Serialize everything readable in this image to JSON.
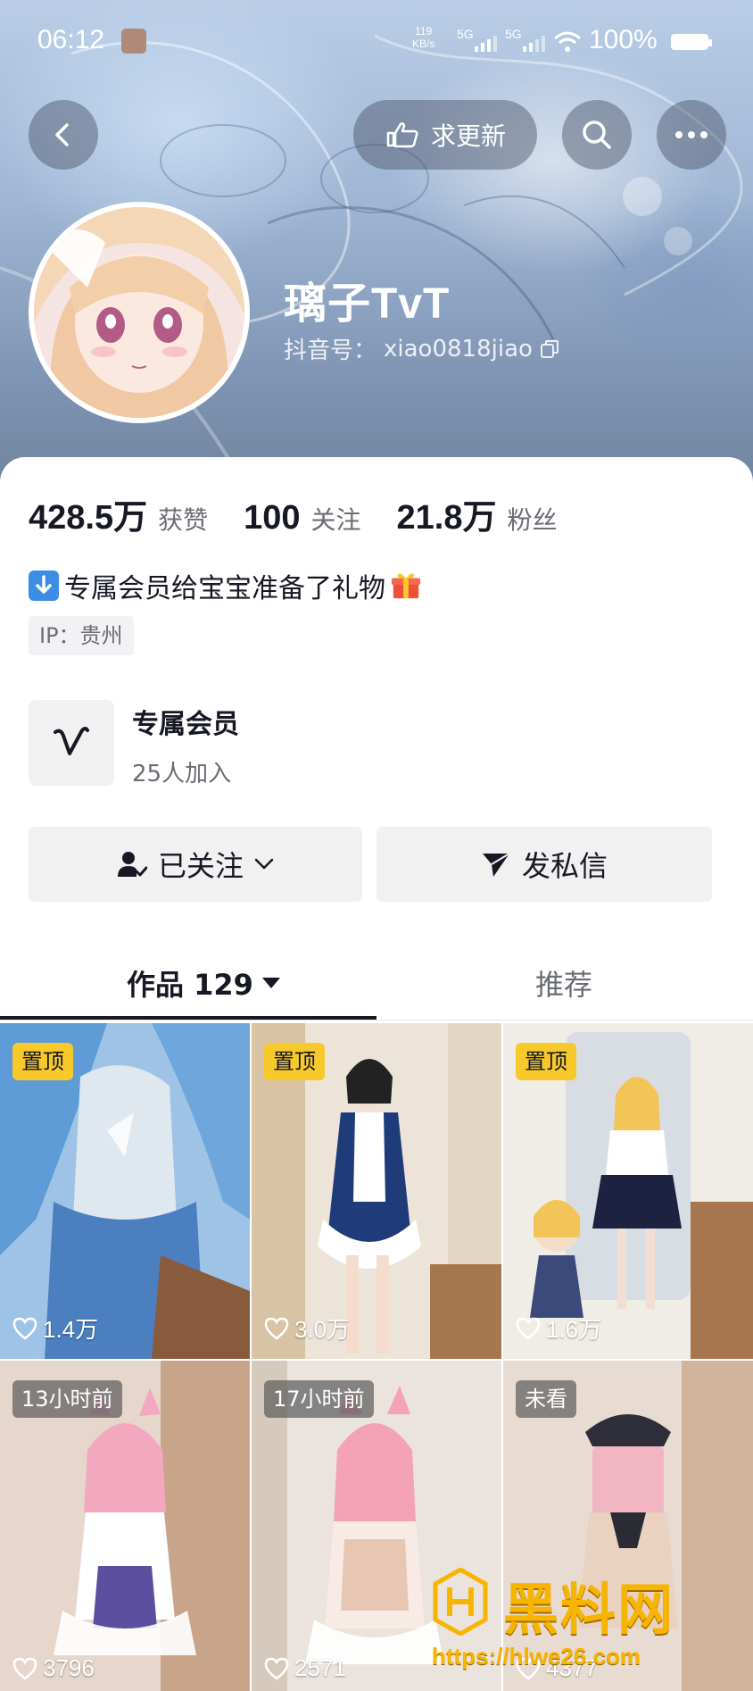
{
  "status_bar": {
    "time": "06:12",
    "net_speed_value": "119",
    "net_speed_unit": "KB/s",
    "signal_1": "5G",
    "signal_2": "5G",
    "battery": "100%"
  },
  "nav": {
    "request_update_label": "求更新"
  },
  "profile": {
    "name": "璃子TvT",
    "douyin_id_label": "抖音号：",
    "douyin_id": "xiao0818jiao"
  },
  "stats": [
    {
      "value": "428.5万",
      "label": "获赞"
    },
    {
      "value": "100",
      "label": "关注"
    },
    {
      "value": "21.8万",
      "label": "粉丝"
    }
  ],
  "bio": {
    "text": "专属会员给宝宝准备了礼物"
  },
  "ip": "IP：贵州",
  "membership": {
    "title": "专属会员",
    "subtitle": "25人加入"
  },
  "actions": {
    "following_label": "已关注",
    "message_label": "发私信"
  },
  "tabs": {
    "works_label": "作品 129",
    "recommend_label": "推荐"
  },
  "videos": [
    {
      "badge": "置顶",
      "likes": "1.4万"
    },
    {
      "badge": "置顶",
      "likes": "3.0万"
    },
    {
      "badge": "置顶",
      "likes": "1.6万"
    },
    {
      "badge": "13小时前",
      "likes": "3796"
    },
    {
      "badge": "17小时前",
      "likes": "2571"
    },
    {
      "badge": "未看",
      "likes": "4377"
    }
  ],
  "watermark": {
    "text": "黑料网",
    "url": "https://hlwe26.com"
  },
  "colors": {
    "pin_badge": "#f8c92b",
    "text_primary": "#161823",
    "text_secondary": "#6b6d75",
    "button_bg": "#f1f1f2",
    "watermark": "#f7b500"
  },
  "icons": [
    "back-arrow-icon",
    "hand-pointer-icon",
    "search-icon",
    "more-icon",
    "copy-icon",
    "down-arrow-icon",
    "gift-icon",
    "v-logo-icon",
    "user-check-icon",
    "chevron-down-icon",
    "send-icon",
    "caret-down-icon",
    "heart-icon"
  ]
}
